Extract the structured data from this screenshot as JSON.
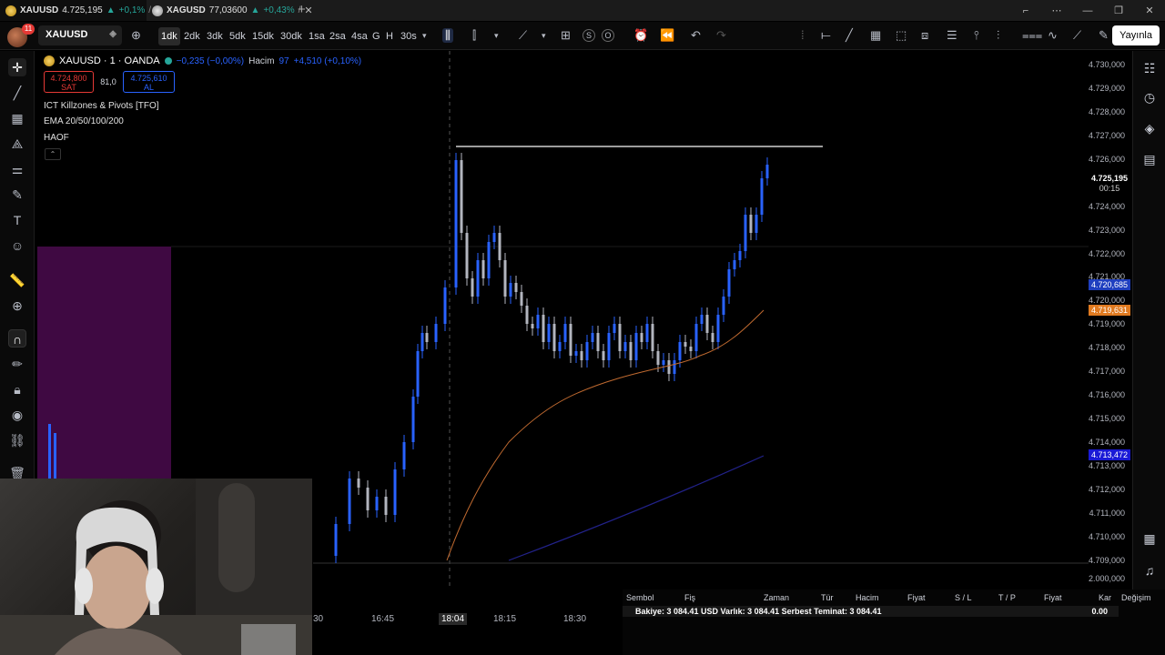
{
  "browser": {
    "tabs": [
      {
        "symbol": "XAUUSD",
        "price": "4.725,195",
        "arrow": "▲",
        "change": "+0,1%",
        "separator": "/",
        "active": true
      },
      {
        "symbol": "XAGUSD",
        "price": "77,03600",
        "arrow": "▲",
        "change": "+0,43%",
        "separator": "/",
        "active": false
      }
    ],
    "new_tab": "+",
    "window_controls": [
      "⌐",
      "⋯",
      "—",
      "❐",
      "✕"
    ]
  },
  "toolbar": {
    "notification_count": "11",
    "symbol": "XAUUSD",
    "intervals": [
      "1dk",
      "2dk",
      "3dk",
      "5dk",
      "15dk",
      "30dk",
      "1sa",
      "2sa",
      "4sa",
      "G",
      "H",
      "30s"
    ],
    "selected_interval": "1dk",
    "publish_label": "Yayınla",
    "icons": [
      "plus-icon",
      "candles-icon",
      "chevron-down-icon",
      "bar-style-icon",
      "indicators-icon",
      "layout-grid-icon",
      "s-icon",
      "o-icon",
      "alert-icon",
      "replay-icon",
      "undo-icon",
      "redo-icon",
      "ray-icon",
      "trendline-icon",
      "grid-icon",
      "rectangle-icon",
      "fib-icon",
      "lines-icon",
      "vertical-icon",
      "channel-icon",
      "parallel-icon",
      "pattern-icon",
      "path-icon",
      "brush-icon"
    ]
  },
  "legend": {
    "symbol_title": "XAUUSD · 1 · OANDA",
    "change": "−0,235 (−0,00%)",
    "volume_label": "Hacim",
    "volume_value": "97",
    "volume_change": "+4,510 (+0,10%)",
    "sell_price": "4.724,800",
    "sell_label": "SAT",
    "spread": "81,0",
    "buy_price": "4.725,610",
    "buy_label": "AL",
    "indicators": [
      "ICT Killzones & Pivots [TFO]",
      "EMA 20/50/100/200",
      "HAOF"
    ],
    "collapse": "⌃"
  },
  "price_axis": {
    "ticks": [
      "4.730,000",
      "4.729,000",
      "4.728,000",
      "4.727,000",
      "4.726,000",
      "4.724,000",
      "4.723,000",
      "4.722,000",
      "4.721,000",
      "4.720,000",
      "4.719,000",
      "4.718,000",
      "4.717,000",
      "4.716,000",
      "4.715,000",
      "4.714,000",
      "4.713,000",
      "4.712,000",
      "4.711,000",
      "4.710,000",
      "4.709,000",
      "2.000,000"
    ],
    "current_price": "4.725,195",
    "countdown": "00:15",
    "ema_blue_1": "4.720,685",
    "ema_orange": "4.719,631",
    "ema_blue_2": "4.713,472"
  },
  "time_axis": {
    "labels": [
      "30",
      "16:45",
      "18:04",
      "18:15",
      "18:30"
    ],
    "highlighted": "18:04"
  },
  "trading_panel": {
    "columns": [
      "Sembol",
      "Fiş",
      "Zaman",
      "Tür",
      "Hacim",
      "Fiyat",
      "S / L",
      "T / P",
      "Fiyat",
      "Kar",
      "Değişim"
    ],
    "balance_row": "Bakiye: 3 084.41 USD  Varlık: 3 084.41  Serbest Teminat: 3 084.41",
    "balance_value": "0.00"
  },
  "colors": {
    "up_candle": "#2962ff",
    "down_candle": "#b2b5be",
    "ema_orange": "#e0813a",
    "ema_blue": "#2a2ab8",
    "killzone": "#5a0a5e",
    "accent": "#2962ff",
    "sell": "#e53935"
  }
}
